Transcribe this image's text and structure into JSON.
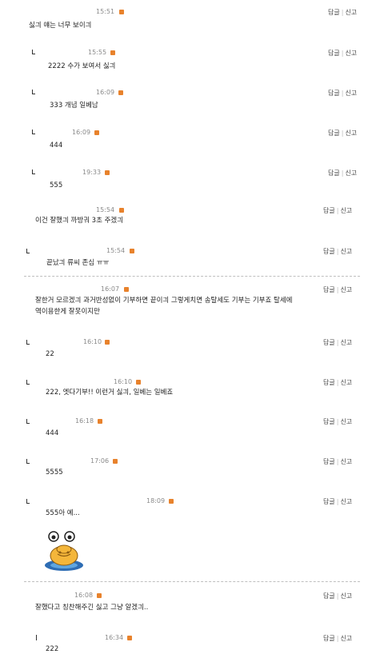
{
  "comments": [
    {
      "time": "15:51",
      "text": "싫긔 얘는 너무 보이긔",
      "reply": "답글",
      "report": "신고"
    },
    {
      "time": "15:55",
      "text": "2222 수가 보여서 싫긔",
      "reply": "답글",
      "report": "신고"
    },
    {
      "time": "16:09",
      "text": "333 개념 일베남",
      "reply": "답글",
      "report": "신고"
    },
    {
      "time": "16:09",
      "text": "444",
      "reply": "답글",
      "report": "신고"
    },
    {
      "time": "19:33",
      "text": "555",
      "reply": "답글",
      "report": "신고"
    },
    {
      "time": "15:54",
      "text": "이건 잘했긔 까방궈 3초 주겠긔",
      "reply": "답글",
      "report": "신고"
    },
    {
      "time": "15:54",
      "text": "끝났긔 류씨 존심 ㅠㅠ",
      "reply": "답글",
      "report": "신고"
    },
    {
      "time": "16:07",
      "text": "잘한거 모르겠긔 과거반성없이 기부하면 끝이긔 그렇게치면 송탈세도 기부는 기부죠 탈세에",
      "text2": "역이용한게 잘못이지만",
      "reply": "답글",
      "report": "신고"
    },
    {
      "time": "16:10",
      "text": "22",
      "reply": "답글",
      "report": "신고"
    },
    {
      "time": "16:10",
      "text": "222, 엣다기부!! 이런거 싫긔, 일베는 일베죠",
      "reply": "답글",
      "report": "신고"
    },
    {
      "time": "16:18",
      "text": "444",
      "reply": "답글",
      "report": "신고"
    },
    {
      "time": "17:06",
      "text": "5555",
      "reply": "답글",
      "report": "신고"
    },
    {
      "time": "18:09",
      "text": "555아 예...",
      "reply": "답글",
      "report": "신고"
    },
    {
      "time": "16:08",
      "text": "잘했다고 칭찬해주긴 싫고 그냥 알겠긔..",
      "reply": "답글",
      "report": "신고"
    },
    {
      "time": "16:34",
      "text": "222",
      "reply": "답글",
      "report": "신고"
    }
  ],
  "icons": {
    "new_badge": "new-badge-icon",
    "reply_arrow": "reply-arrow-icon",
    "emoticon": "cartoon-emoticon"
  },
  "colors": {
    "badge": "#e8822c",
    "divider": "#bfbfbf"
  }
}
